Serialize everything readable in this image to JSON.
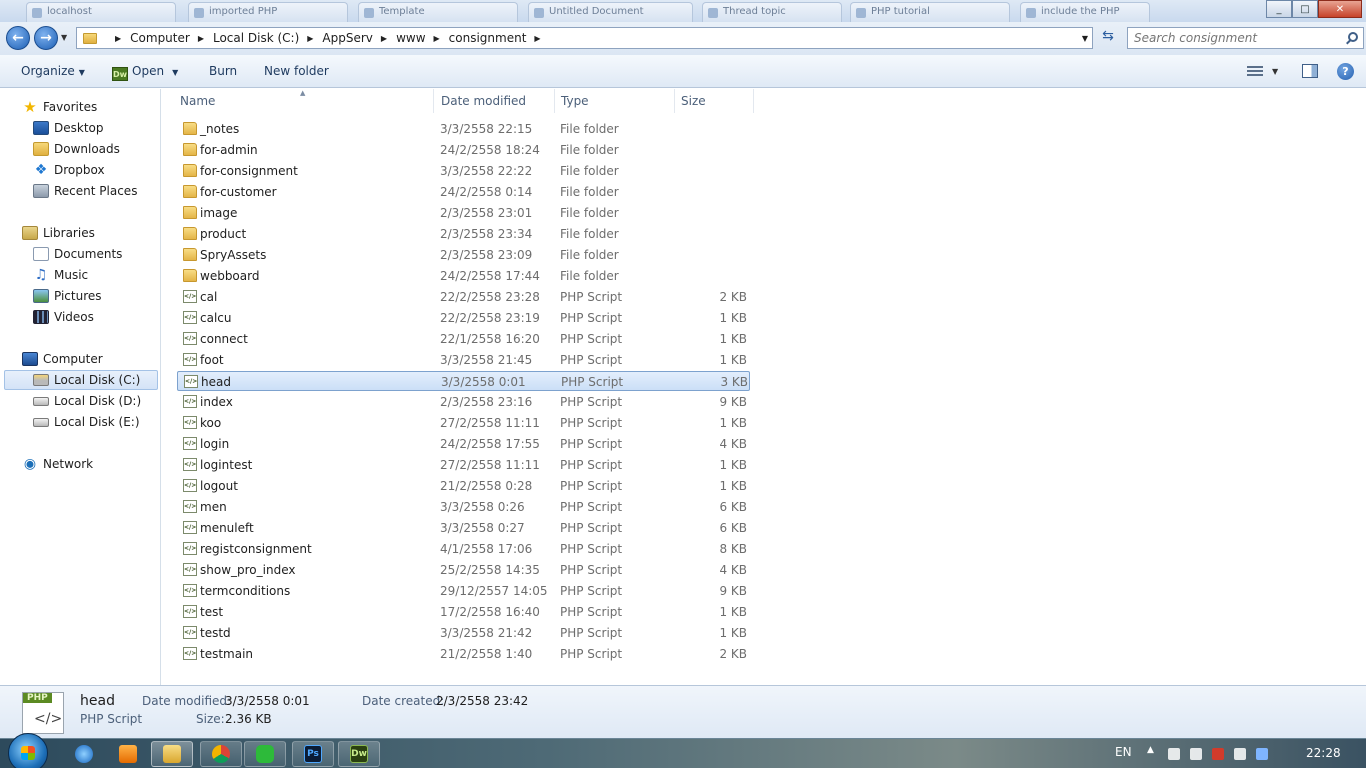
{
  "titlebar": {
    "tabs": [
      "localhost",
      "imported PHP",
      "Template",
      "Untitled Document",
      "Thread topic",
      "PHP tutorial",
      "include the PHP"
    ],
    "minimize": "_",
    "maximize": "□",
    "close": "✕"
  },
  "address": {
    "crumbs": [
      "Computer",
      "Local Disk (C:)",
      "AppServ",
      "www",
      "consignment"
    ],
    "search_placeholder": "Search consignment"
  },
  "toolbar": {
    "organize": "Organize",
    "open": "Open",
    "dw_badge": "Dw",
    "burn": "Burn",
    "new_folder": "New folder",
    "help": "?"
  },
  "nav": {
    "favorites": "Favorites",
    "desktop": "Desktop",
    "downloads": "Downloads",
    "dropbox": "Dropbox",
    "recent": "Recent Places",
    "libraries": "Libraries",
    "documents": "Documents",
    "music": "Music",
    "pictures": "Pictures",
    "videos": "Videos",
    "computer": "Computer",
    "disk_c": "Local Disk (C:)",
    "disk_d": "Local Disk (D:)",
    "disk_e": "Local Disk (E:)",
    "network": "Network"
  },
  "columns": {
    "name": "Name",
    "date": "Date modified",
    "type": "Type",
    "size": "Size"
  },
  "files": [
    {
      "name": "_notes",
      "date": "3/3/2558 22:15",
      "type": "File folder",
      "size": "",
      "kind": "folder"
    },
    {
      "name": "for-admin",
      "date": "24/2/2558 18:24",
      "type": "File folder",
      "size": "",
      "kind": "folder"
    },
    {
      "name": "for-consignment",
      "date": "3/3/2558 22:22",
      "type": "File folder",
      "size": "",
      "kind": "folder"
    },
    {
      "name": "for-customer",
      "date": "24/2/2558 0:14",
      "type": "File folder",
      "size": "",
      "kind": "folder"
    },
    {
      "name": "image",
      "date": "2/3/2558 23:01",
      "type": "File folder",
      "size": "",
      "kind": "folder"
    },
    {
      "name": "product",
      "date": "2/3/2558 23:34",
      "type": "File folder",
      "size": "",
      "kind": "folder"
    },
    {
      "name": "SpryAssets",
      "date": "2/3/2558 23:09",
      "type": "File folder",
      "size": "",
      "kind": "folder"
    },
    {
      "name": "webboard",
      "date": "24/2/2558 17:44",
      "type": "File folder",
      "size": "",
      "kind": "folder"
    },
    {
      "name": "cal",
      "date": "22/2/2558 23:28",
      "type": "PHP Script",
      "size": "2 KB",
      "kind": "php"
    },
    {
      "name": "calcu",
      "date": "22/2/2558 23:19",
      "type": "PHP Script",
      "size": "1 KB",
      "kind": "php"
    },
    {
      "name": "connect",
      "date": "22/1/2558 16:20",
      "type": "PHP Script",
      "size": "1 KB",
      "kind": "php"
    },
    {
      "name": "foot",
      "date": "3/3/2558 21:45",
      "type": "PHP Script",
      "size": "1 KB",
      "kind": "php"
    },
    {
      "name": "head",
      "date": "3/3/2558 0:01",
      "type": "PHP Script",
      "size": "3 KB",
      "kind": "php",
      "selected": true
    },
    {
      "name": "index",
      "date": "2/3/2558 23:16",
      "type": "PHP Script",
      "size": "9 KB",
      "kind": "php"
    },
    {
      "name": "koo",
      "date": "27/2/2558 11:11",
      "type": "PHP Script",
      "size": "1 KB",
      "kind": "php"
    },
    {
      "name": "login",
      "date": "24/2/2558 17:55",
      "type": "PHP Script",
      "size": "4 KB",
      "kind": "php"
    },
    {
      "name": "logintest",
      "date": "27/2/2558 11:11",
      "type": "PHP Script",
      "size": "1 KB",
      "kind": "php"
    },
    {
      "name": "logout",
      "date": "21/2/2558 0:28",
      "type": "PHP Script",
      "size": "1 KB",
      "kind": "php"
    },
    {
      "name": "men",
      "date": "3/3/2558 0:26",
      "type": "PHP Script",
      "size": "6 KB",
      "kind": "php"
    },
    {
      "name": "menuleft",
      "date": "3/3/2558 0:27",
      "type": "PHP Script",
      "size": "6 KB",
      "kind": "php"
    },
    {
      "name": "registconsignment",
      "date": "4/1/2558 17:06",
      "type": "PHP Script",
      "size": "8 KB",
      "kind": "php"
    },
    {
      "name": "show_pro_index",
      "date": "25/2/2558 14:35",
      "type": "PHP Script",
      "size": "4 KB",
      "kind": "php"
    },
    {
      "name": "termconditions",
      "date": "29/12/2557 14:05",
      "type": "PHP Script",
      "size": "9 KB",
      "kind": "php"
    },
    {
      "name": "test",
      "date": "17/2/2558 16:40",
      "type": "PHP Script",
      "size": "1 KB",
      "kind": "php"
    },
    {
      "name": "testd",
      "date": "3/3/2558 21:42",
      "type": "PHP Script",
      "size": "1 KB",
      "kind": "php"
    },
    {
      "name": "testmain",
      "date": "21/2/2558 1:40",
      "type": "PHP Script",
      "size": "2 KB",
      "kind": "php"
    }
  ],
  "details": {
    "badge": "PHP",
    "name": "head",
    "type": "PHP Script",
    "date_modified_label": "Date modified:",
    "date_modified": "3/3/2558 0:01",
    "size_label": "Size:",
    "size": "2.36 KB",
    "date_created_label": "Date created:",
    "date_created": "2/3/2558 23:42"
  },
  "taskbar": {
    "apps": [
      {
        "name": "internet-explorer",
        "label": "",
        "icon": "tbi-ie",
        "state": ""
      },
      {
        "name": "media-player",
        "label": "",
        "icon": "tbi-media",
        "state": ""
      },
      {
        "name": "windows-explorer",
        "label": "",
        "icon": "tbi-explorer",
        "state": "active"
      },
      {
        "name": "chrome",
        "label": "",
        "icon": "tbi-chrome",
        "state": "open"
      },
      {
        "name": "line",
        "label": "",
        "icon": "tbi-line",
        "state": "open"
      },
      {
        "name": "photoshop",
        "label": "Ps",
        "icon": "tbi-ps",
        "state": "open"
      },
      {
        "name": "dreamweaver",
        "label": "Dw",
        "icon": "tbi-dw",
        "state": "open"
      }
    ],
    "language": "EN",
    "clock": "22:28"
  }
}
